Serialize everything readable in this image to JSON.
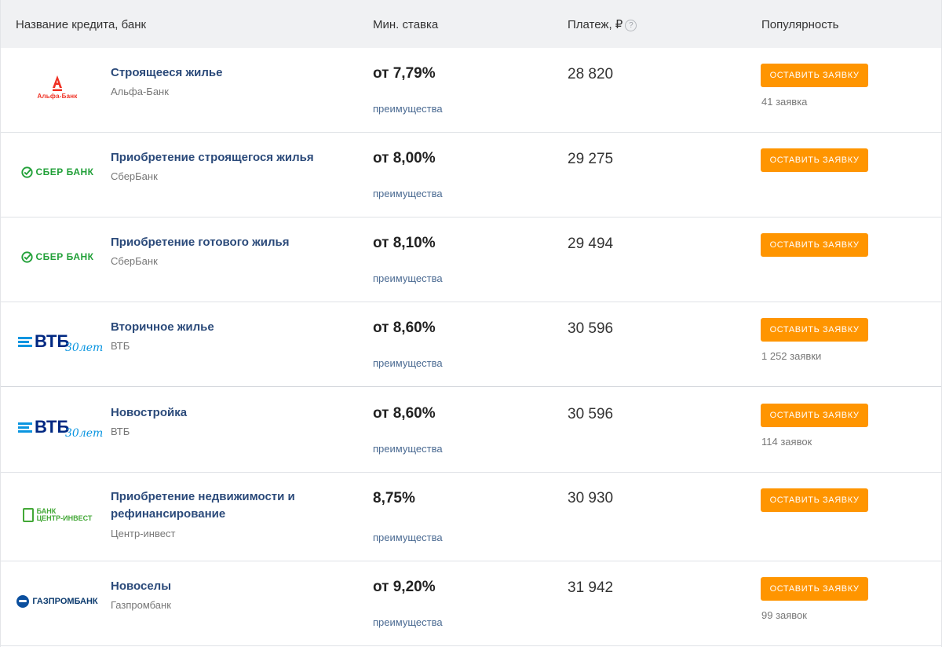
{
  "header": {
    "name": "Название кредита, банк",
    "rate": "Мин. ставка",
    "payment": "Платеж, ₽",
    "payment_help": "?",
    "popularity": "Популярность"
  },
  "button_label": "ОСТАВИТЬ ЗАЯВКУ",
  "rows": [
    {
      "logo": "alfa-bank-logo",
      "logo_caption": "Альфа-Банк",
      "title": "Строящееся жилье",
      "bank": "Альфа-Банк",
      "rate": "от 7,79%",
      "advantages": "преимущества",
      "payment": "28 820",
      "applications": "41 заявка"
    },
    {
      "logo": "sberbank-logo",
      "logo_caption": "СБЕР БАНК",
      "title": "Приобретение строящегося жилья",
      "bank": "СберБанк",
      "rate": "от 8,00%",
      "advantages": "преимущества",
      "payment": "29 275",
      "applications": ""
    },
    {
      "logo": "sberbank-logo",
      "logo_caption": "СБЕР БАНК",
      "title": "Приобретение готового жилья",
      "bank": "СберБанк",
      "rate": "от 8,10%",
      "advantages": "преимущества",
      "payment": "29 494",
      "applications": ""
    },
    {
      "logo": "vtb-logo",
      "logo_caption": "ВТБ",
      "logo_caption_2": "30лет",
      "title": "Вторичное жилье",
      "bank": "ВТБ",
      "rate": "от 8,60%",
      "advantages": "преимущества",
      "payment": "30 596",
      "applications": "1 252 заявки"
    },
    {
      "logo": "vtb-logo",
      "logo_caption": "ВТБ",
      "logo_caption_2": "30лет",
      "title": "Новостройка",
      "bank": "ВТБ",
      "rate": "от 8,60%",
      "advantages": "преимущества",
      "payment": "30 596",
      "applications": "114 заявок"
    },
    {
      "logo": "centr-invest-logo",
      "logo_caption": "БАНК",
      "logo_caption_2": "ЦЕНТР-ИНВЕСТ",
      "title": "Приобретение недвижимости и рефинансирование",
      "bank": "Центр-инвест",
      "rate": "8,75%",
      "advantages": "преимущества",
      "payment": "30 930",
      "applications": ""
    },
    {
      "logo": "gazprombank-logo",
      "logo_caption": "ГАЗПРОМБАНК",
      "title": "Новоселы",
      "bank": "Газпромбанк",
      "rate": "от 9,20%",
      "advantages": "преимущества",
      "payment": "31 942",
      "applications": "99 заявок"
    }
  ]
}
